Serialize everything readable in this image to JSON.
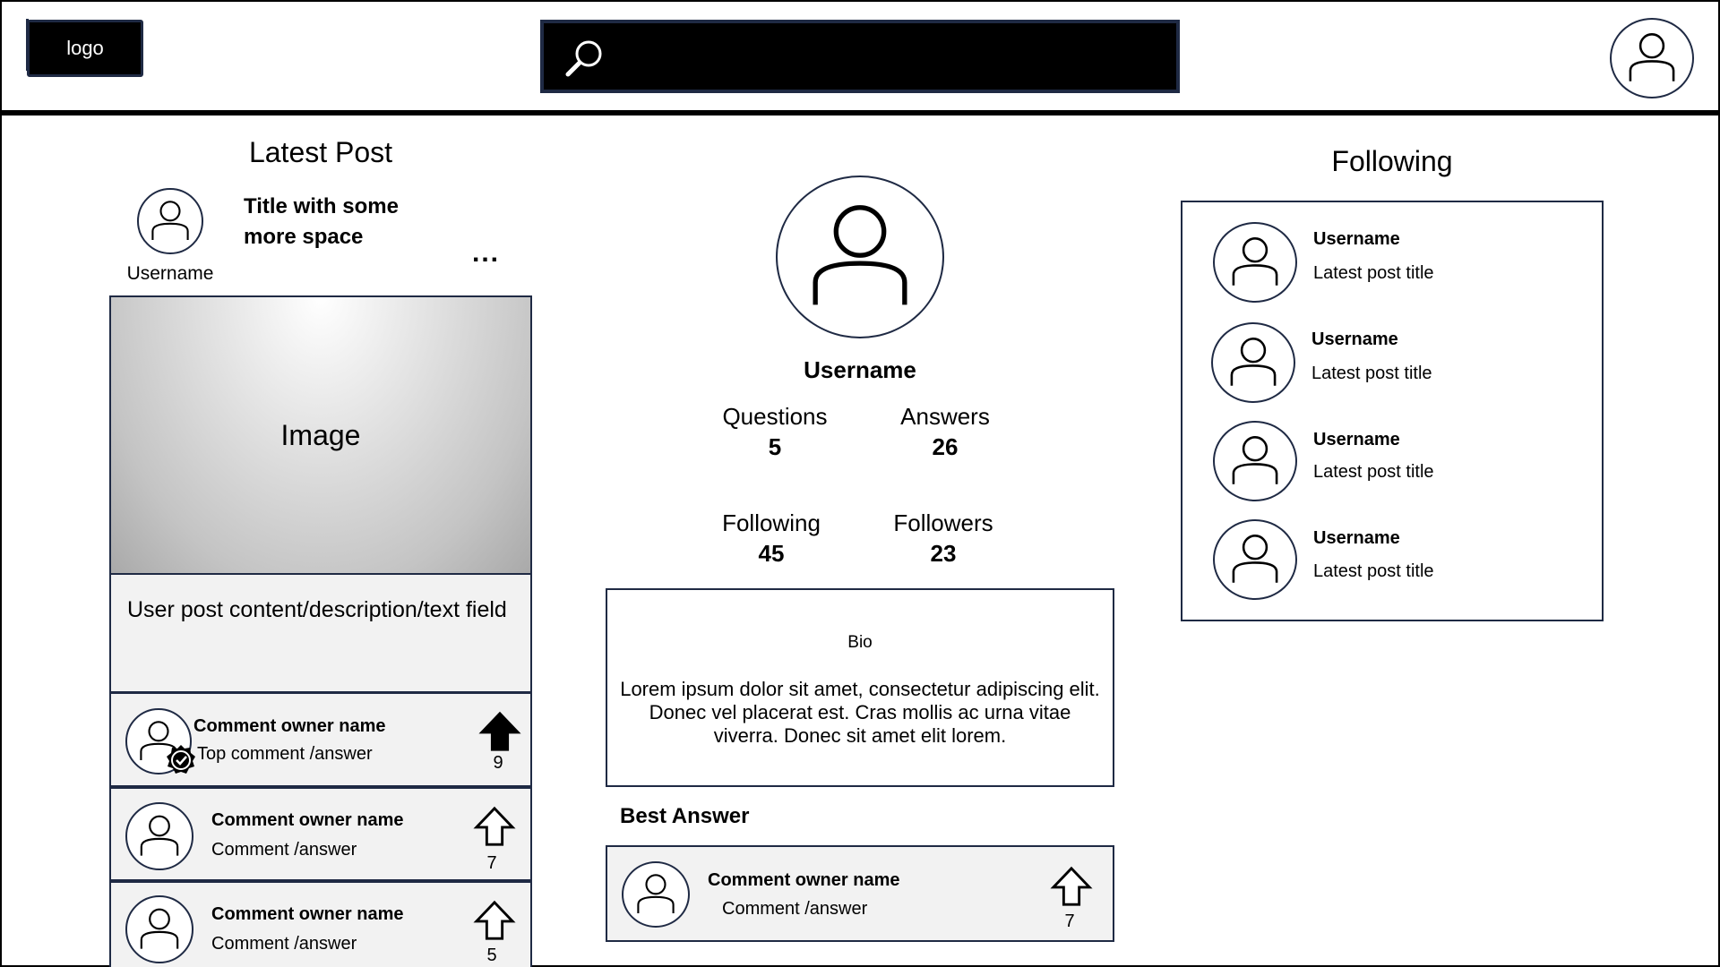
{
  "header": {
    "logo_label": "logo",
    "search_placeholder": ""
  },
  "latest_post": {
    "section_title": "Latest Post",
    "author": "Username",
    "title": "Title with some more space",
    "menu_label": "...",
    "image_label": "Image",
    "content": "User post content/description/text field",
    "comments": [
      {
        "owner": "Comment  owner name",
        "text": "Top comment /answer",
        "votes": "9",
        "top": true
      },
      {
        "owner": "Comment  owner name",
        "text": "Comment /answer",
        "votes": "7",
        "top": false
      },
      {
        "owner": "Comment  owner name",
        "text": "Comment /answer",
        "votes": "5",
        "top": false
      }
    ]
  },
  "profile": {
    "username": "Username",
    "stats": {
      "questions_label": "Questions",
      "questions_value": "5",
      "answers_label": "Answers",
      "answers_value": "26",
      "following_label": "Following",
      "following_value": "45",
      "followers_label": "Followers",
      "followers_value": "23"
    },
    "bio_label": "Bio",
    "bio_text": "Lorem ipsum dolor sit amet, consectetur adipiscing elit. Donec vel placerat est. Cras mollis ac urna vitae viverra. Donec sit amet elit lorem.",
    "best_answer": {
      "label": "Best Answer",
      "owner": "Comment  owner name",
      "text": "Comment /answer",
      "votes": "7"
    }
  },
  "following": {
    "section_title": "Following",
    "items": [
      {
        "username": "Username",
        "latest_post": "Latest post title"
      },
      {
        "username": "Username",
        "latest_post": "Latest post title"
      },
      {
        "username": "Username",
        "latest_post": "Latest post title"
      },
      {
        "username": "Username",
        "latest_post": "Latest post title"
      }
    ]
  },
  "colors": {
    "outline": "#1f2a44",
    "panel": "#f2f2f2",
    "header_bar": "#000000"
  }
}
